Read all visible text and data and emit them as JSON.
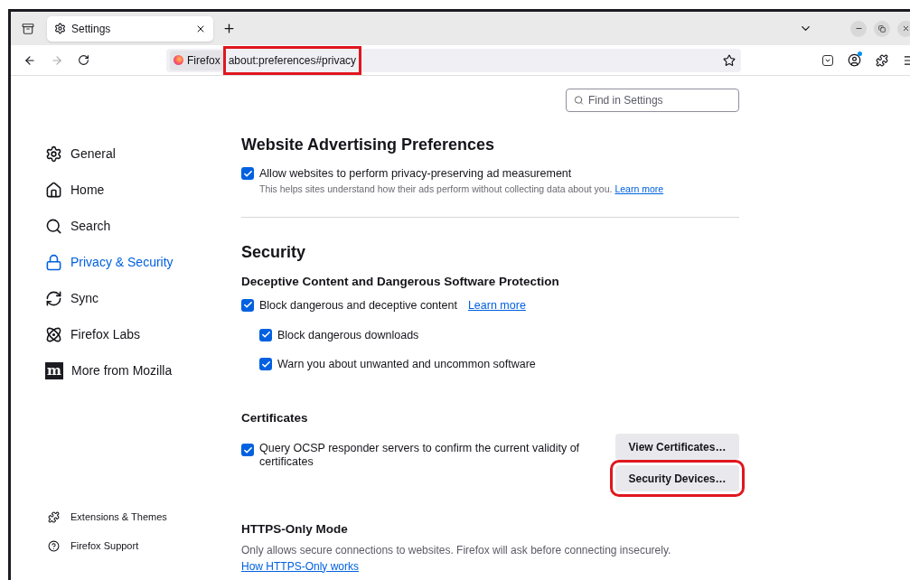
{
  "tab": {
    "title": "Settings",
    "selected": true
  },
  "address_bar": {
    "identity": "Firefox",
    "url": "about:preferences#privacy",
    "highlighted": true
  },
  "search": {
    "placeholder": "Find in Settings"
  },
  "sidebar": {
    "items": [
      {
        "label": "General",
        "selected": false
      },
      {
        "label": "Home",
        "selected": false
      },
      {
        "label": "Search",
        "selected": false
      },
      {
        "label": "Privacy & Security",
        "selected": true
      },
      {
        "label": "Sync",
        "selected": false
      },
      {
        "label": "Firefox Labs",
        "selected": false
      },
      {
        "label": "More from Mozilla",
        "selected": false,
        "logo_text": "m"
      }
    ],
    "footer": [
      {
        "label": "Extensions & Themes"
      },
      {
        "label": "Firefox Support"
      }
    ]
  },
  "ad_prefs": {
    "heading": "Website Advertising Preferences",
    "checkbox": {
      "label": "Allow websites to perform privacy-preserving ad measurement",
      "checked": true
    },
    "description": "This helps sites understand how their ads perform without collecting data about you.",
    "link": "Learn more"
  },
  "security": {
    "heading": "Security",
    "protection": {
      "heading": "Deceptive Content and Dangerous Software Protection",
      "checkbox": {
        "label": "Block dangerous and deceptive content",
        "checked": true,
        "link": "Learn more",
        "children": [
          {
            "label": "Block dangerous downloads",
            "checked": true
          },
          {
            "label": "Warn you about unwanted and uncommon software",
            "checked": true
          }
        ]
      }
    },
    "certificates": {
      "heading": "Certificates",
      "checkbox": {
        "label": "Query OCSP responder servers to confirm the current validity of certificates",
        "checked": true
      },
      "buttons": [
        {
          "label": "View Certificates…",
          "highlighted": false
        },
        {
          "label": "Security Devices…",
          "highlighted": true
        }
      ]
    },
    "https_only": {
      "heading": "HTTPS-Only Mode",
      "description": "Only allows secure connections to websites. Firefox will ask before connecting insecurely.",
      "link": "How HTTPS-Only works"
    }
  }
}
